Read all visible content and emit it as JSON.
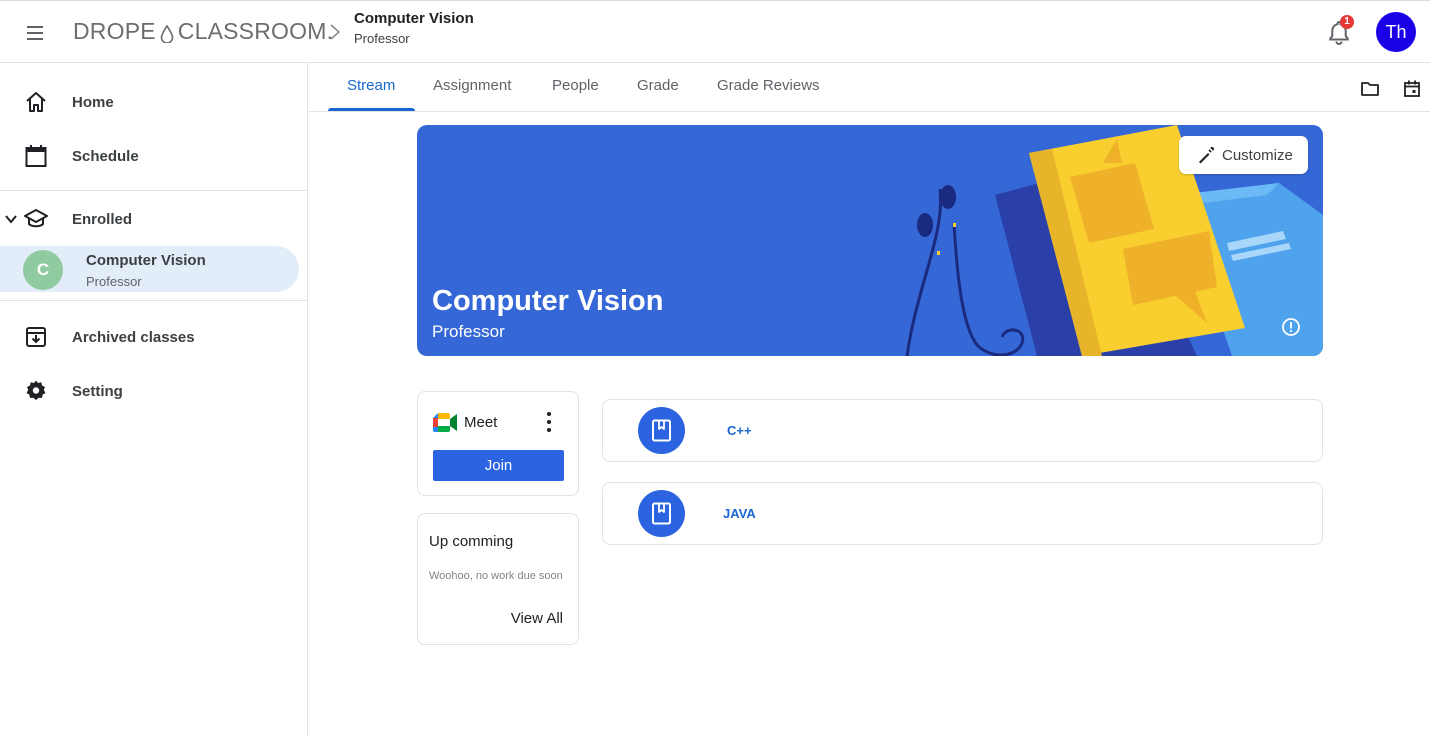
{
  "header": {
    "logo_left": "DROPE",
    "logo_right": "CLASSROOM.",
    "class_title": "Computer Vision",
    "class_role": "Professor",
    "notification_count": "1",
    "avatar_initials": "Th"
  },
  "sidebar": {
    "home": "Home",
    "schedule": "Schedule",
    "enrolled": "Enrolled",
    "class": {
      "initial": "C",
      "title": "Computer Vision",
      "role": "Professor"
    },
    "archived": "Archived classes",
    "setting": "Setting"
  },
  "tabs": [
    "Stream",
    "Assignment",
    "People",
    "Grade",
    "Grade Reviews"
  ],
  "banner": {
    "title": "Computer Vision",
    "subtitle": "Professor",
    "customize_label": "Customize",
    "color": "#3567d6"
  },
  "meet": {
    "label": "Meet",
    "join_label": "Join"
  },
  "upcoming": {
    "title": "Up comming",
    "empty_text": "Woohoo, no work due soon",
    "view_all": "View All"
  },
  "posts": [
    {
      "name": "C++"
    },
    {
      "name": "JAVA"
    }
  ],
  "colors": {
    "accent": "#1967d2",
    "button": "#2b63e0",
    "avatar": "#1a00e6",
    "selected_bg": "#e3edfa"
  }
}
